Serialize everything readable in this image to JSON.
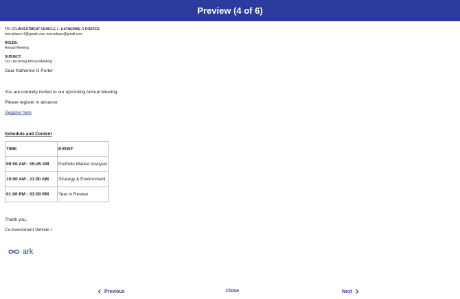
{
  "header": {
    "title": "Preview (4 of 6)"
  },
  "email": {
    "to_label": "TO: Co-Investment Vehicle I - Katherine G Porter",
    "to_emails": "test.arkpes+2@gmail.com, test.arkpes@gmail.com",
    "roles_label": "ROLES:",
    "roles_value": "Annual Meeting",
    "subject_label": "SUBJECT:",
    "subject_value": "Our Upcoming Annual Meeting!",
    "greeting": "Dear Katherine G Porter",
    "invite": "You are cordially invited to our upcoming Annual Meeting.",
    "register_prompt": "Please register in advance:",
    "register_link": "Register here",
    "schedule_title": "Schedule and Content",
    "schedule_headers": [
      "TIME",
      "EVENT"
    ],
    "schedule_rows": [
      {
        "time": "09:00 AM - 09:45 AM",
        "event": "Portfolio Market Analysis"
      },
      {
        "time": "10:00 AM - 11:00 AM",
        "event": "Strategy & Environment"
      },
      {
        "time": "01:00 PM - 03:00 PM",
        "event": "Year in Review"
      }
    ],
    "thanks": "Thank you,",
    "signature": "Co-Investment Vehicle I",
    "logo_text": "ark"
  },
  "footer": {
    "previous_label": "Previous",
    "close_label": "Close",
    "next_label": "Next"
  },
  "colors": {
    "accent": "#2d3c9c"
  }
}
